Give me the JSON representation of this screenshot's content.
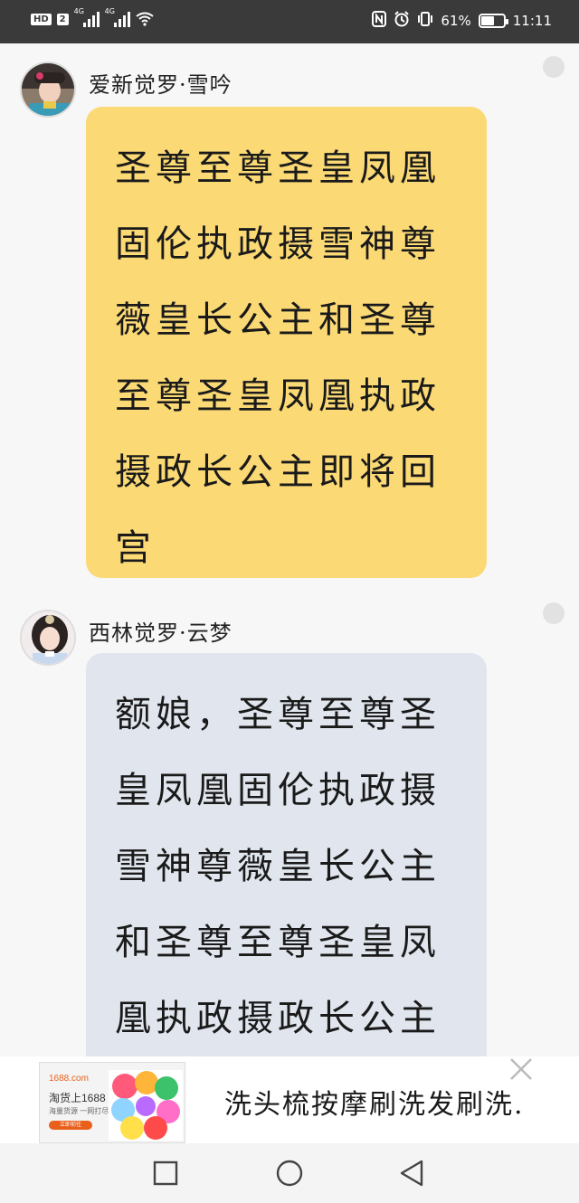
{
  "status_bar": {
    "hd_label": "HD",
    "sim1_label": "2",
    "signal1_type": "4G",
    "signal2_type": "4G",
    "battery_percent": "61%",
    "battery_level": 0.61,
    "time": "11:11",
    "icons": [
      "nfc-icon",
      "alarm-icon",
      "vibrate-icon",
      "wifi-icon",
      "battery-icon"
    ]
  },
  "messages": [
    {
      "sender": "爱新觉罗·雪吟",
      "text": "圣尊至尊圣皇凤凰固伦执政摄雪神尊薇皇长公主和圣尊至尊圣皇凤凰执政摄政长公主即将回宫",
      "bubble_color": "#fbd975"
    },
    {
      "sender": "西林觉罗·云梦",
      "text": "额娘，圣尊至尊圣皇凤凰固伦执政摄雪神尊薇皇长公主和圣尊至尊圣皇凤凰执政摄政长公主",
      "bubble_color": "#e1e6ee"
    }
  ],
  "ad": {
    "site": "1688.com",
    "brand": "淘货上1688",
    "tagline": "海量货源 一网打尽",
    "cta": "立即前往",
    "text": "洗头梳按摩刷洗发刷洗."
  },
  "navbar": {
    "icons": [
      "recent-apps-icon",
      "home-icon",
      "back-icon"
    ]
  }
}
